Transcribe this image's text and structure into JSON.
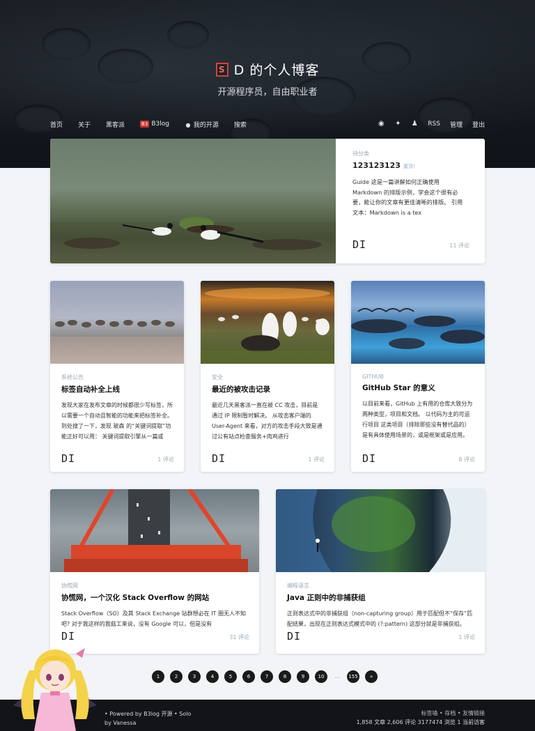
{
  "site": {
    "title": "D 的个人博客",
    "subtitle": "开源程序员，自由职业者",
    "logo_text": "S"
  },
  "nav": {
    "left": [
      "首页",
      "关于",
      "黑客派",
      "B3log",
      "我的开源",
      "搜索"
    ],
    "b3_badge": "B3",
    "right": [
      "RSS",
      "管理",
      "登出"
    ]
  },
  "featured": {
    "category": "待分类",
    "title": "123123123",
    "pin_label": "置顶!",
    "excerpt": "Guide 这是一篇讲解如何正确使用 Markdown 的排版示例，学会这个很有必要，能让你的文章有更佳清晰的排版。 引用文本：Markdown is a tex",
    "author": "DI",
    "comments": "11 评论"
  },
  "cards_row1": [
    {
      "category": "系统公告",
      "title": "标签自动补全上线",
      "excerpt": "发现大家在发布文章的时候都很少写标签，所以需要一个自动且智能的功能来把标签补全。 到处搜了一下，发现 玻森 的“关键词提取”功能正好可以用： 关键词提取引擎从一篇或",
      "author": "DI",
      "comments": "1 评论"
    },
    {
      "category": "安全",
      "title": "最近的被攻击记录",
      "excerpt": "最近几天黑客派一直在被 CC 攻击，目前是通过 IP 限制暂时解决。 从攻击客户端的 User-Agent 来看，对方的攻击手段大致是通过公有站点检查服务+肉鸡进行",
      "author": "DI",
      "comments": "1 评论"
    },
    {
      "category": "GITHUB",
      "title": "GitHub Star 的意义",
      "excerpt": "以目前来看，GitHub 上有用的仓库大致分为两种类型，项目和文档。 以代码为主的可运行项目 这类项目（排除那些没有替代品的）是有具体使用场景的，或是框架或是应用。",
      "author": "DI",
      "comments": "8 评论"
    }
  ],
  "cards_row2": [
    {
      "category": "协慌网",
      "title": "协慌网，一个汉化 Stack Overflow 的网站",
      "excerpt": "Stack Overflow（SO）及其 Stack Exchange 站群想必在 IT 圈无人不知吧? 对于我这样的我菇工来说，没有 Google 可以，但是没有",
      "author": "DI",
      "comments": "31 评论"
    },
    {
      "category": "编程语言",
      "title": "Java 正则中的非捕获组",
      "excerpt": "正则表达式中的非捕获组（non-capturing group）用于匹配但不“保存”匹配结果，出现在正则表达式模式中的 (?:pattern) 这部分就是非捕获组。",
      "author": "DI",
      "comments": "1 评论"
    }
  ],
  "pagination": [
    "1",
    "2",
    "3",
    "4",
    "5",
    "6",
    "7",
    "8",
    "9",
    "10",
    "...",
    "155",
    "»"
  ],
  "footer": {
    "powered": "• Powered by B3log 开源 • Solo",
    "by": "by Vanessa",
    "links": "标签墙 • 存档 • 友情链接",
    "stats": "1,858 文章  2,606 评论  3177474 浏览  1 当前访客"
  },
  "colors": {
    "hero_bg": "#14181d",
    "accent_red": "#c33333",
    "muted": "#9aa7b3",
    "footer_bg": "#121417"
  }
}
